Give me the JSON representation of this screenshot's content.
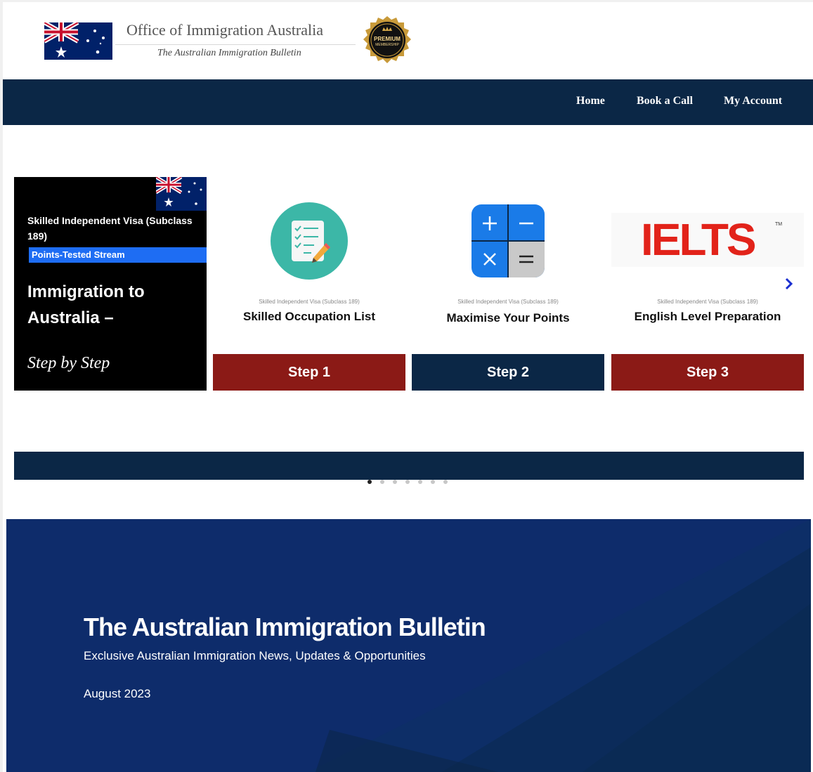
{
  "header": {
    "org_name": "Office of Immigration Australia",
    "org_tagline": "The Australian Immigration Bulletin",
    "badge_line1": "PREMIUM",
    "badge_line2": "MEMBERSHIP",
    "flag_icon": "australian-flag-icon"
  },
  "nav": {
    "items": [
      {
        "label": "Home"
      },
      {
        "label": "Book a Call"
      },
      {
        "label": "My Account"
      }
    ]
  },
  "carousel": {
    "intro": {
      "visa": "Skilled Independent Visa (Subclass 189)",
      "stream": "Points-Tested Stream",
      "title": "Immigration to Australia –",
      "subtitle": "Step by Step"
    },
    "cards": [
      {
        "small": "Skilled Independent Visa (Subclass 189)",
        "title": "Skilled Occupation List",
        "button": "Step 1",
        "button_color": "#8b1a16",
        "icon": "checklist-icon"
      },
      {
        "small": "Skilled Independent Visa (Subclass 189)",
        "title": "Maximise Your Points",
        "button": "Step 2",
        "button_color": "#0b2746",
        "icon": "calculator-icon"
      },
      {
        "small": "Skilled Independent Visa (Subclass 189)",
        "title": "English Level Preparation",
        "button": "Step 3",
        "button_color": "#8b1a16",
        "icon": "ielts-logo",
        "logo_text": "IELTS",
        "logo_tm": "TM"
      }
    ],
    "next_icon": "chevron-right-icon",
    "dots_count": 7,
    "active_dot": 0
  },
  "bulletin": {
    "title": "The Australian Immigration Bulletin",
    "subtitle": "Exclusive Australian Immigration News, Updates & Opportunities",
    "date": "August 2023"
  },
  "colors": {
    "navy": "#0b2746",
    "hero_blue": "#0e2c6b",
    "step_red": "#8b1a16",
    "stream_blue": "#1e6df3",
    "ielts_red": "#e2231a",
    "checklist_teal": "#3cb7a7",
    "calc_blue": "#1a7be8"
  }
}
